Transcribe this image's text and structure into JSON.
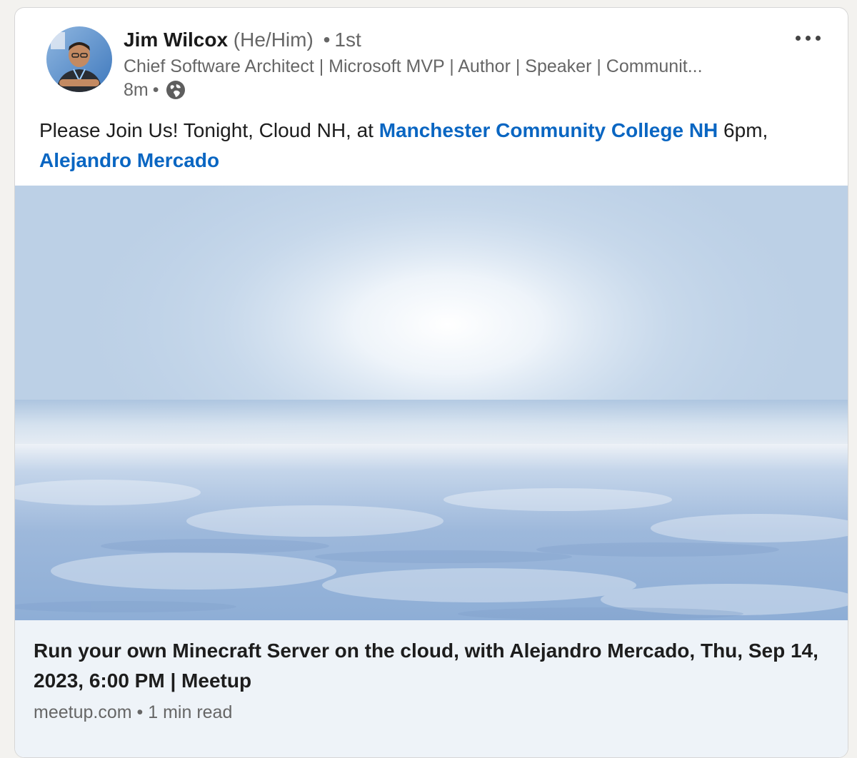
{
  "author": {
    "name": "Jim Wilcox",
    "pronouns": "(He/Him)",
    "separator": "•",
    "degree": "1st",
    "headline": "Chief Software Architect | Microsoft MVP | Author | Speaker | Communit...",
    "time": "8m",
    "visibility_icon": "globe-icon"
  },
  "post": {
    "text_1": "Please Join Us! Tonight, Cloud NH, at ",
    "mention_1": "Manchester Community College NH",
    "text_2": " 6pm, ",
    "mention_2": "Alejandro Mercado"
  },
  "link_preview": {
    "image": "cloud-sea-image",
    "title": "Run your own Minecraft Server on the cloud, with Alejandro Mercado, Thu, Sep 14, 2023, 6:00 PM | Meetup",
    "source": "meetup.com",
    "separator": "•",
    "read_time": "1 min read"
  },
  "colors": {
    "link": "#0a66c2",
    "text": "#1d1d1d",
    "muted": "#666666",
    "footer_bg": "#eef3f8"
  }
}
